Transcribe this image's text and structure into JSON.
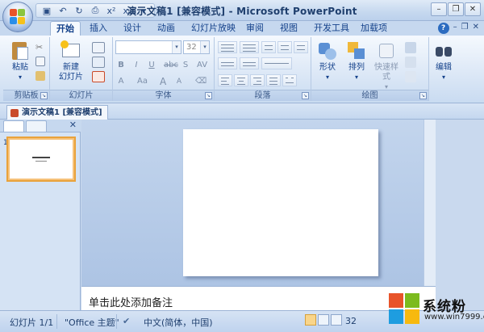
{
  "window": {
    "title": "演示文稿1 [兼容模式] - Microsoft PowerPoint",
    "controls": [
      "minimize",
      "restore",
      "close"
    ]
  },
  "quick_access": [
    "save-icon",
    "undo-icon",
    "redo-icon",
    "print-preview-icon",
    "superscript-icon",
    "subscript-icon",
    "customize-icon"
  ],
  "quick_access_labels": {
    "superscript": "x²",
    "subscript": "x₂"
  },
  "tabs": [
    "开始",
    "插入",
    "设计",
    "动画",
    "幻灯片放映",
    "审阅",
    "视图",
    "开发工具",
    "加载项"
  ],
  "active_tab": "开始",
  "ribbon": {
    "clipboard": {
      "label": "剪贴板",
      "paste": "粘贴"
    },
    "slides": {
      "label": "幻灯片",
      "new_slide_line1": "新建",
      "new_slide_line2": "幻灯片"
    },
    "font": {
      "label": "字体",
      "font_size": "32",
      "buttons": [
        "B",
        "I",
        "U",
        "abc",
        "S",
        "AV"
      ],
      "clear_format": "Aa",
      "grow": "A",
      "shrink": "A"
    },
    "paragraph": {
      "label": "段落"
    },
    "drawing": {
      "label": "绘图",
      "shapes": "形状",
      "arrange": "排列",
      "quick_styles": "快速样式"
    },
    "editing": {
      "label": "编辑"
    }
  },
  "document_tab": "演示文稿1 [兼容模式]",
  "slide_panel": {
    "slide_number": "1"
  },
  "notes_placeholder": "单击此处添加备注",
  "status": {
    "slide": "幻灯片 1/1",
    "theme": "\"Office 主题\"",
    "language": "中文(简体，中国)",
    "zoom": "32"
  },
  "watermark": {
    "brand": "系统粉",
    "url": "www.win7999.com"
  },
  "colors": {
    "accent": "#15428b",
    "ribbon_bg": "#dbe7f6",
    "thumb_border": "#e9a23b"
  }
}
